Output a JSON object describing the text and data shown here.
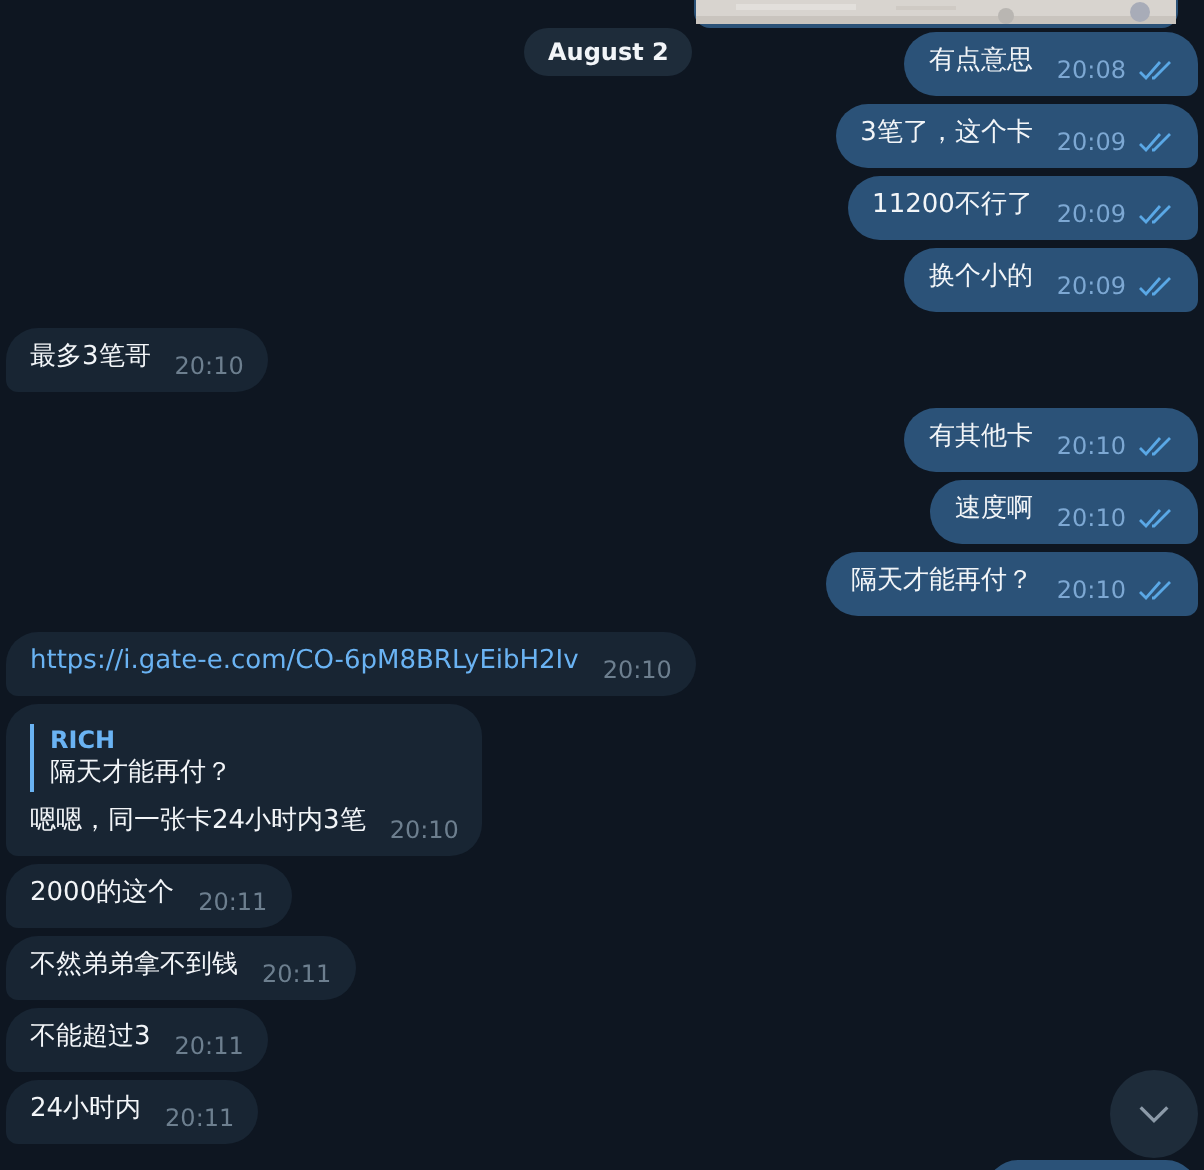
{
  "date_badge": "August 2",
  "groups": [
    {
      "outgoing": true,
      "messages": [
        {
          "kind": "text",
          "text": "有点意思",
          "time": "20:08",
          "read": true
        },
        {
          "kind": "text",
          "text": "3笔了，这个卡",
          "time": "20:09",
          "read": true
        },
        {
          "kind": "text",
          "text": "11200不行了",
          "time": "20:09",
          "read": true
        },
        {
          "kind": "text",
          "text": "换个小的",
          "time": "20:09",
          "read": true
        }
      ]
    },
    {
      "outgoing": false,
      "messages": [
        {
          "kind": "text",
          "text": "最多3笔哥",
          "time": "20:10"
        }
      ]
    },
    {
      "outgoing": true,
      "messages": [
        {
          "kind": "text",
          "text": "有其他卡",
          "time": "20:10",
          "read": true
        },
        {
          "kind": "text",
          "text": "速度啊",
          "time": "20:10",
          "read": true
        },
        {
          "kind": "text",
          "text": "隔天才能再付？",
          "time": "20:10",
          "read": true
        }
      ]
    },
    {
      "outgoing": false,
      "messages": [
        {
          "kind": "link",
          "text": "https://i.gate-e.com/CO-6pM8BRLyEibH2Iv",
          "time": "20:10"
        },
        {
          "kind": "reply",
          "reply": {
            "author": "RICH",
            "text": "隔天才能再付？"
          },
          "text": "嗯嗯，同一张卡24小时内3笔",
          "time": "20:10"
        },
        {
          "kind": "text",
          "text": "2000的这个",
          "time": "20:11"
        },
        {
          "kind": "text",
          "text": "不然弟弟拿不到钱",
          "time": "20:11"
        },
        {
          "kind": "text",
          "text": "不能超过3",
          "time": "20:11"
        },
        {
          "kind": "text",
          "text": "24小时内",
          "time": "20:11"
        }
      ]
    }
  ],
  "next_message_partly_visible": true
}
